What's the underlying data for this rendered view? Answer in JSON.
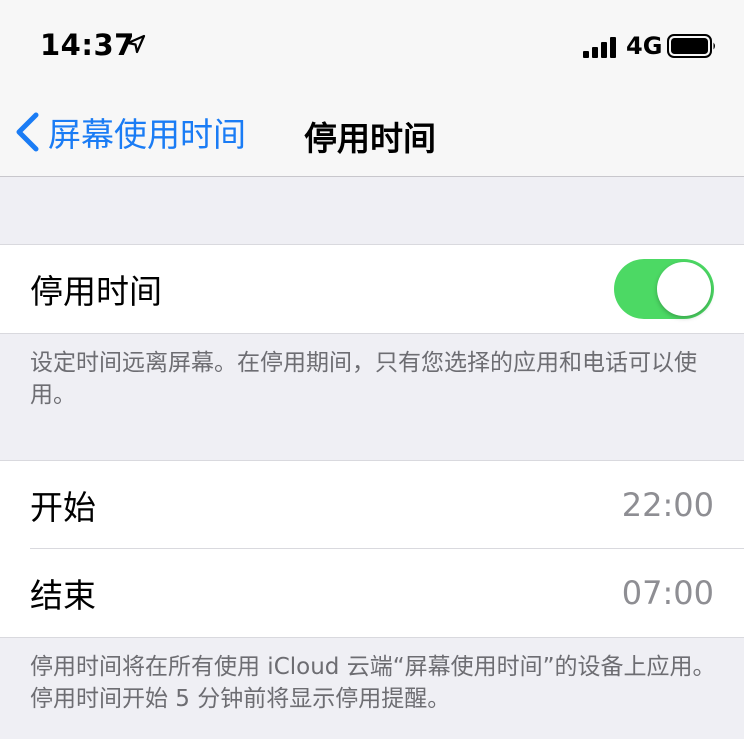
{
  "status_bar": {
    "time": "14:37",
    "network": "4G",
    "location_icon": "location-arrow-icon",
    "signal_icon": "cellular-signal-icon",
    "battery_icon": "battery-full-icon"
  },
  "nav": {
    "back_label": "屏幕使用时间",
    "title": "停用时间"
  },
  "downtime": {
    "label": "停用时间",
    "enabled": true,
    "footer": "设定时间远离屏幕。在停用期间，只有您选择的应用和电话可以使用。"
  },
  "schedule": {
    "start_label": "开始",
    "start_value": "22:00",
    "end_label": "结束",
    "end_value": "07:00",
    "footer": "停用时间将在所有使用 iCloud 云端“屏幕使用时间”的设备上应用。停用时间开始 5 分钟前将显示停用提醒。"
  },
  "colors": {
    "accent": "#1a7cf5",
    "toggle_on": "#4cd964",
    "background": "#efeff4"
  }
}
